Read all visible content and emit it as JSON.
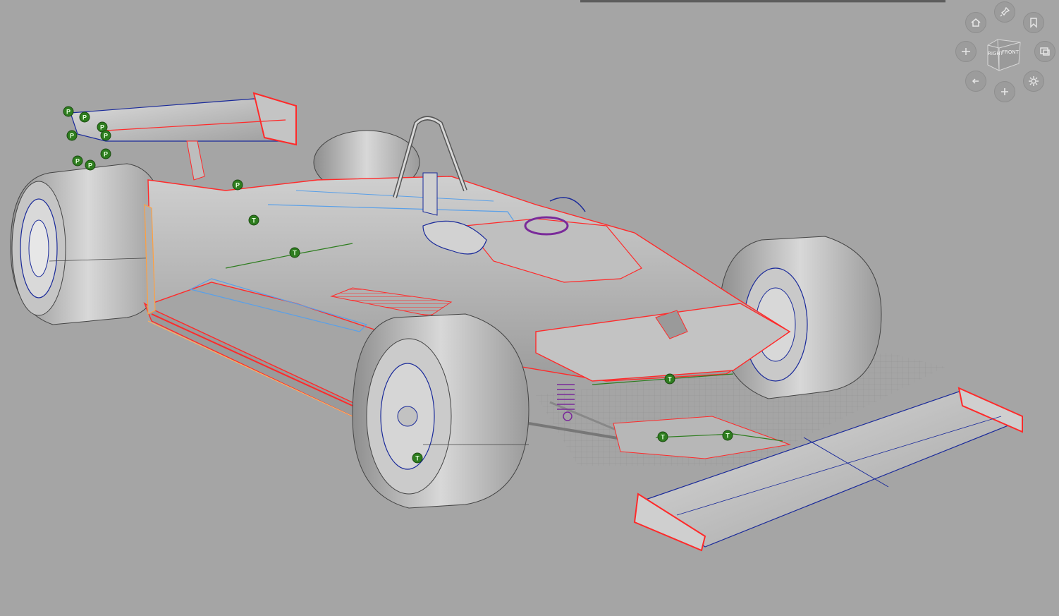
{
  "app": {
    "view_cube": {
      "face_front": "FRONT",
      "face_right": "RIGHT"
    },
    "nav_icons": [
      "home-icon",
      "pin-icon",
      "bookmark-icon",
      "look-icon",
      "window-icon",
      "back-arrow-icon",
      "zoom-plus-icon",
      "settings-gear-icon"
    ]
  },
  "model_markers": {
    "p_label": "P",
    "t_label": "T"
  },
  "colors": {
    "background": "#a5a5a5",
    "body_fill": "#b9b9b9",
    "edge_red": "#ff2a2a",
    "edge_blue": "#1a2a9a",
    "edge_cyan": "#5aa0e8",
    "marker_green": "#2e7d1f",
    "purple": "#7a2a9a"
  }
}
